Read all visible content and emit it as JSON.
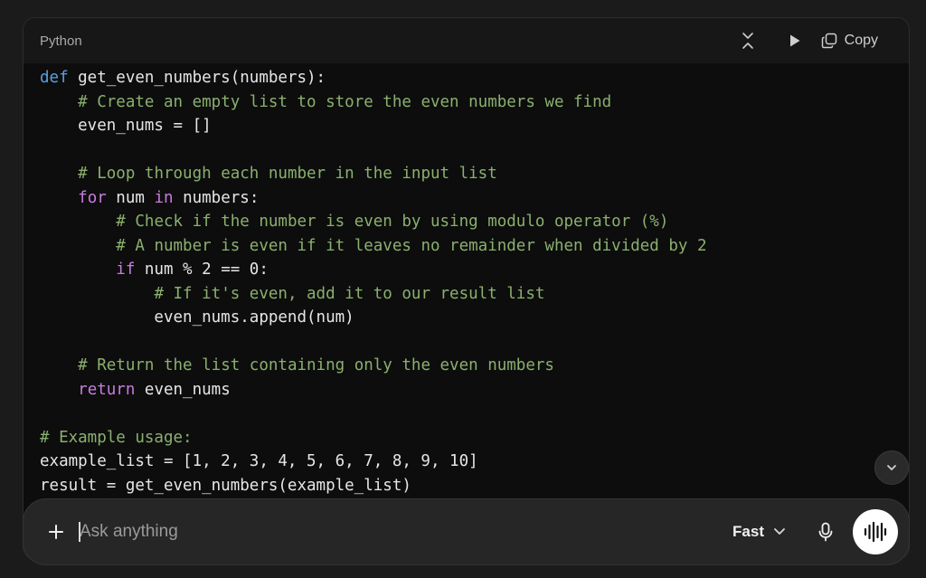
{
  "code_block": {
    "language": "Python",
    "actions": {
      "collapse_icon": "collapse-vertical-icon",
      "run_icon": "play-icon",
      "copy_label": "Copy",
      "copy_icon": "copy-icon"
    },
    "lines": [
      [
        {
          "t": "kwdef",
          "v": "def"
        },
        {
          "t": "pl",
          "v": " get_even_numbers(numbers):"
        }
      ],
      [
        {
          "t": "pl",
          "v": "    "
        },
        {
          "t": "cm",
          "v": "# Create an empty list to store the even numbers we find"
        }
      ],
      [
        {
          "t": "pl",
          "v": "    even_nums = []"
        }
      ],
      [
        {
          "t": "pl",
          "v": ""
        }
      ],
      [
        {
          "t": "pl",
          "v": "    "
        },
        {
          "t": "cm",
          "v": "# Loop through each number in the input list"
        }
      ],
      [
        {
          "t": "pl",
          "v": "    "
        },
        {
          "t": "kw",
          "v": "for"
        },
        {
          "t": "pl",
          "v": " num "
        },
        {
          "t": "kw",
          "v": "in"
        },
        {
          "t": "pl",
          "v": " numbers:"
        }
      ],
      [
        {
          "t": "pl",
          "v": "        "
        },
        {
          "t": "cm",
          "v": "# Check if the number is even by using modulo operator (%)"
        }
      ],
      [
        {
          "t": "pl",
          "v": "        "
        },
        {
          "t": "cm",
          "v": "# A number is even if it leaves no remainder when divided by 2"
        }
      ],
      [
        {
          "t": "pl",
          "v": "        "
        },
        {
          "t": "kw",
          "v": "if"
        },
        {
          "t": "pl",
          "v": " num % 2 == 0:"
        }
      ],
      [
        {
          "t": "pl",
          "v": "            "
        },
        {
          "t": "cm",
          "v": "# If it's even, add it to our result list"
        }
      ],
      [
        {
          "t": "pl",
          "v": "            even_nums.append(num)"
        }
      ],
      [
        {
          "t": "pl",
          "v": ""
        }
      ],
      [
        {
          "t": "pl",
          "v": "    "
        },
        {
          "t": "cm",
          "v": "# Return the list containing only the even numbers"
        }
      ],
      [
        {
          "t": "pl",
          "v": "    "
        },
        {
          "t": "kw",
          "v": "return"
        },
        {
          "t": "pl",
          "v": " even_nums"
        }
      ],
      [
        {
          "t": "pl",
          "v": ""
        }
      ],
      [
        {
          "t": "cm",
          "v": "# Example usage:"
        }
      ],
      [
        {
          "t": "pl",
          "v": "example_list = [1, 2, 3, 4, 5, 6, 7, 8, 9, 10]"
        }
      ],
      [
        {
          "t": "pl",
          "v": "result = get_even_numbers(example_list)"
        }
      ]
    ]
  },
  "scroll_button": {
    "icon": "chevron-down-icon"
  },
  "composer": {
    "add_icon": "plus-icon",
    "placeholder": "Ask anything",
    "value": "",
    "mode": {
      "label": "Fast",
      "icon": "chevron-down-icon"
    },
    "mic_icon": "microphone-icon",
    "voice_icon": "voice-waveform-icon"
  },
  "colors": {
    "background": "#1b1b1b",
    "code_bg": "#0d0d0d",
    "keyword": "#c87ce0",
    "def_keyword": "#5aa0e0",
    "comment": "#8ab06e",
    "text": "#e6e6e6"
  }
}
